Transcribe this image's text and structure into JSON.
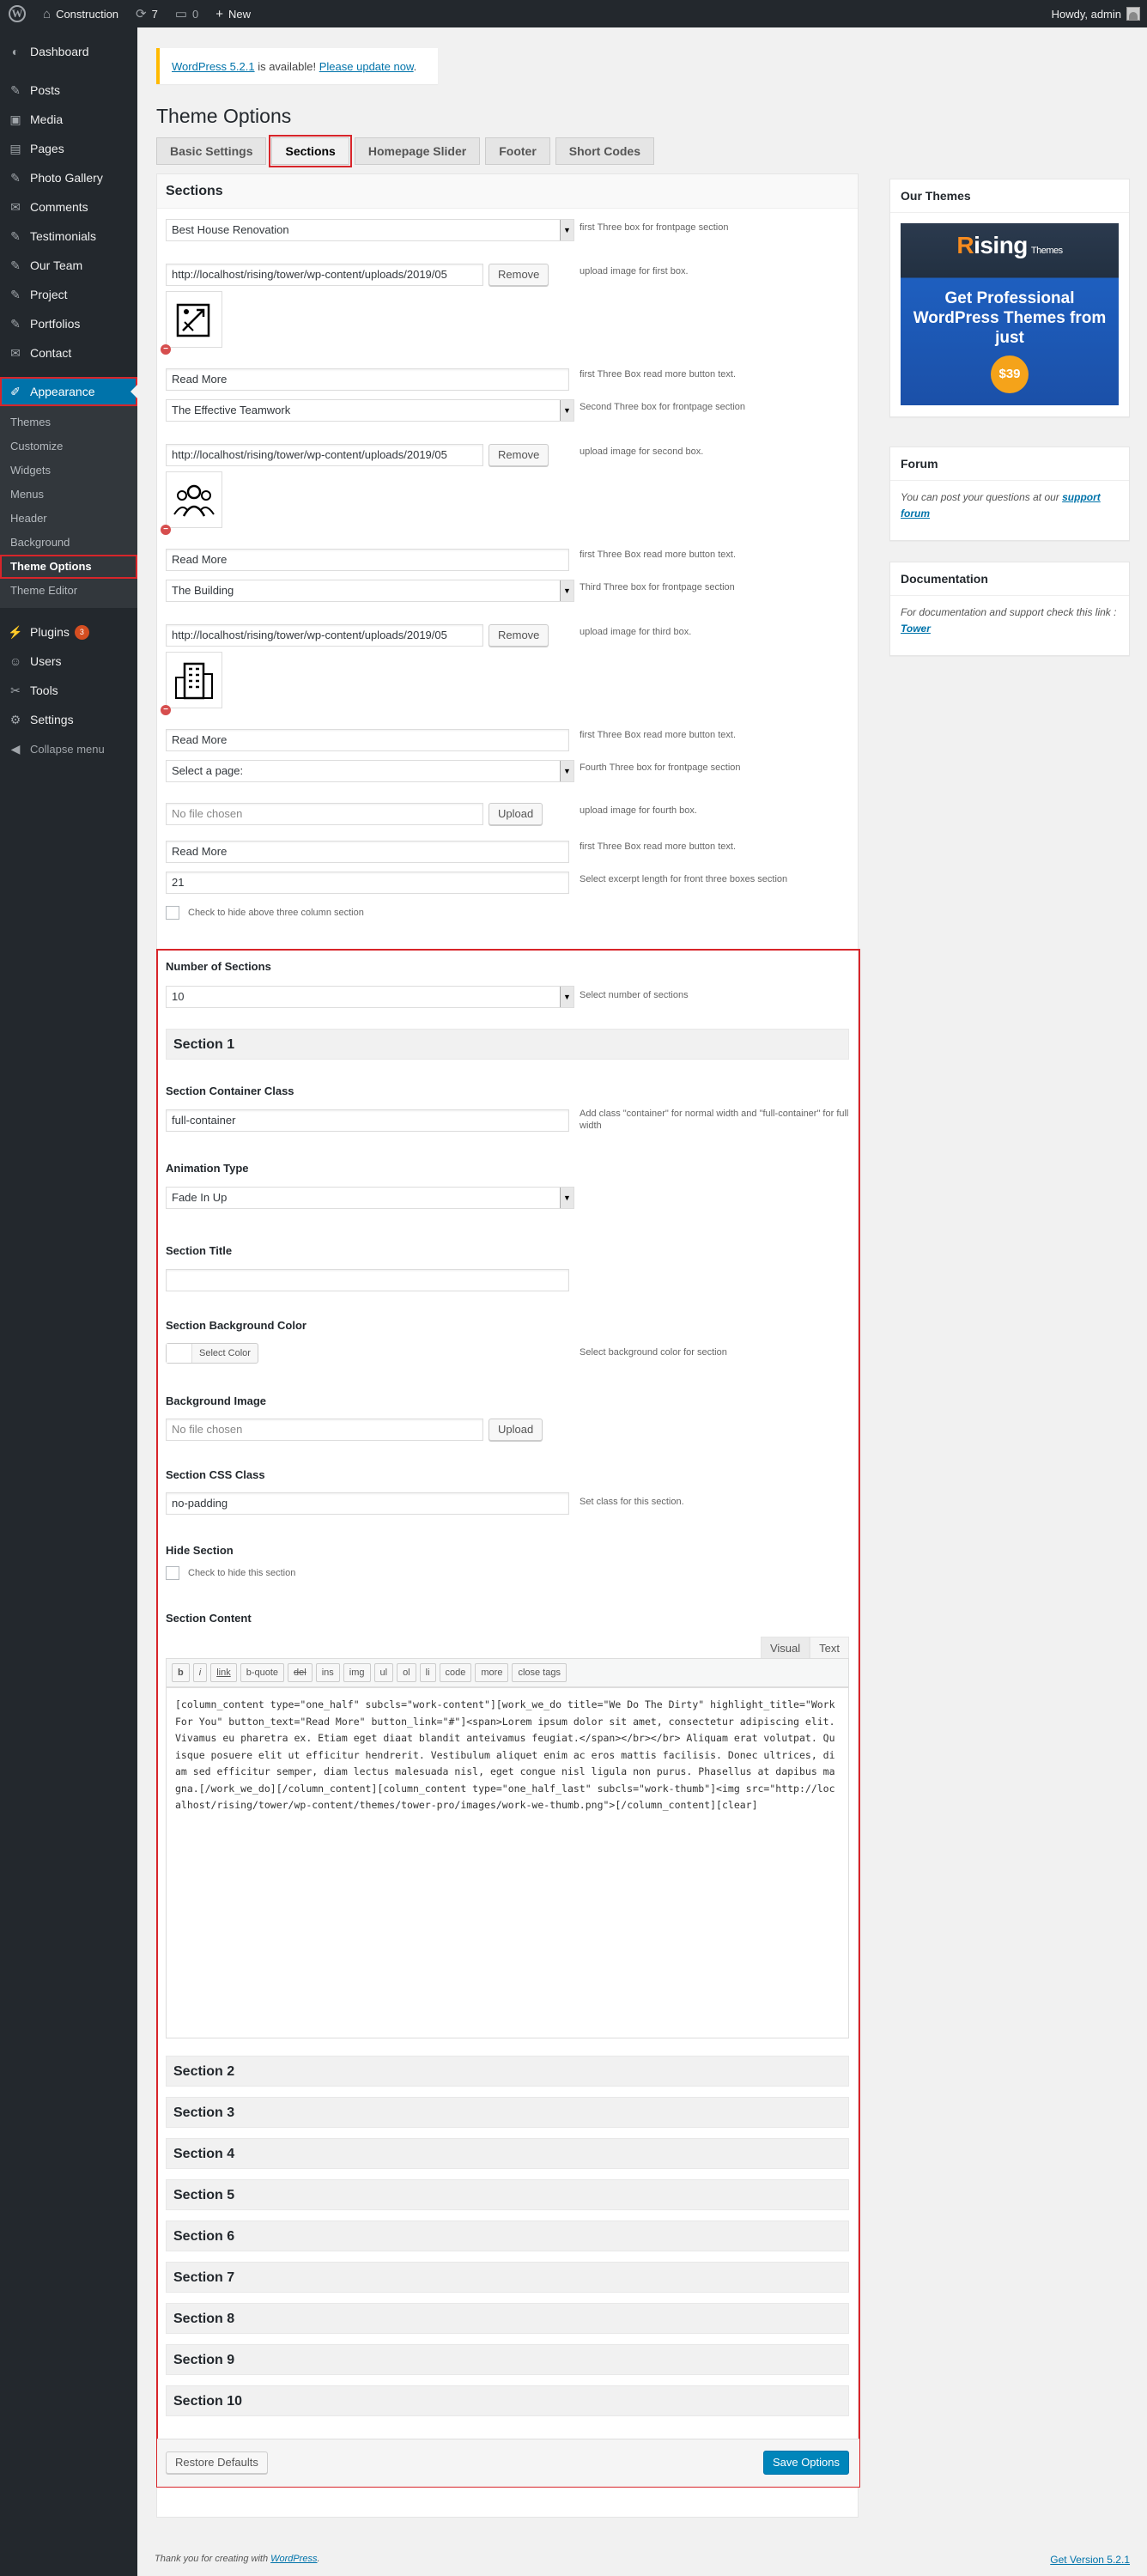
{
  "adminbar": {
    "site_name": "Construction",
    "updates_count": "7",
    "comments_count": "0",
    "new_label": "New",
    "greeting": "Howdy, admin"
  },
  "sidebar": {
    "items": [
      {
        "label": "Dashboard",
        "icon": "dashboard-icon",
        "glyph": "◐"
      },
      {
        "label": "Posts",
        "icon": "pin-icon",
        "glyph": "✎"
      },
      {
        "label": "Media",
        "icon": "media-icon",
        "glyph": "▣"
      },
      {
        "label": "Pages",
        "icon": "pages-icon",
        "glyph": "▤"
      },
      {
        "label": "Photo Gallery",
        "icon": "pin-icon",
        "glyph": "✎"
      },
      {
        "label": "Comments",
        "icon": "comments-icon",
        "glyph": "✉"
      },
      {
        "label": "Testimonials",
        "icon": "pin-icon",
        "glyph": "✎"
      },
      {
        "label": "Our Team",
        "icon": "pin-icon",
        "glyph": "✎"
      },
      {
        "label": "Project",
        "icon": "pin-icon",
        "glyph": "✎"
      },
      {
        "label": "Portfolios",
        "icon": "pin-icon",
        "glyph": "✎"
      },
      {
        "label": "Contact",
        "icon": "mail-icon",
        "glyph": "✉"
      },
      {
        "label": "Appearance",
        "icon": "brush-icon",
        "glyph": "✐"
      },
      {
        "label": "Plugins",
        "icon": "plugin-icon",
        "glyph": "⚡",
        "badge": "3"
      },
      {
        "label": "Users",
        "icon": "users-icon",
        "glyph": "☺"
      },
      {
        "label": "Tools",
        "icon": "wrench-icon",
        "glyph": "✂"
      },
      {
        "label": "Settings",
        "icon": "settings-icon",
        "glyph": "⚙"
      }
    ],
    "appearance_sub": [
      "Themes",
      "Customize",
      "Widgets",
      "Menus",
      "Header",
      "Background",
      "Theme Options",
      "Theme Editor"
    ],
    "collapse_label": "Collapse menu"
  },
  "notice": {
    "link_text": "WordPress 5.2.1",
    "middle_text": " is available! ",
    "update_link": "Please update now",
    "end": "."
  },
  "page_title": "Theme Options",
  "tabs": [
    "Basic Settings",
    "Sections",
    "Homepage Slider",
    "Footer",
    "Short Codes"
  ],
  "active_tab": "Sections",
  "panel_title": "Sections",
  "boxes": {
    "box1_page": "Best House Renovation",
    "box1_page_desc": "first Three box for frontpage section",
    "box1_image_url": "http://localhost/rising/tower/wp-content/uploads/2019/05",
    "box1_image_desc": "upload image for first box.",
    "box1_btn_text": "Read More",
    "box1_btn_desc": "first Three Box read more button text.",
    "box2_page": "The Effective Teamwork",
    "box2_page_desc": "Second Three box for frontpage section",
    "box2_image_url": "http://localhost/rising/tower/wp-content/uploads/2019/05",
    "box2_image_desc": "upload image for second box.",
    "box2_btn_text": "Read More",
    "box2_btn_desc": "first Three Box read more button text.",
    "box3_page": "The Building",
    "box3_page_desc": "Third Three box for frontpage section",
    "box3_image_url": "http://localhost/rising/tower/wp-content/uploads/2019/05",
    "box3_image_desc": "upload image for third box.",
    "box3_btn_text": "Read More",
    "box3_btn_desc": "first Three Box read more button text.",
    "box4_page": "Select a page:",
    "box4_page_desc": "Fourth Three box for frontpage section",
    "box4_image_placeholder": "No file chosen",
    "box4_image_desc": "upload image for fourth box.",
    "box4_btn_text": "Read More",
    "box4_btn_desc": "first Three Box read more button text.",
    "excerpt_length": "21",
    "excerpt_desc": "Select excerpt length for front three boxes section",
    "hide_label": "Check to hide above three column section",
    "remove_label": "Remove",
    "upload_label": "Upload"
  },
  "sections": {
    "number_label": "Number of Sections",
    "number_value": "10",
    "number_desc": "Select number of sections",
    "section1_title": "Section 1",
    "container_class_label": "Section Container Class",
    "container_class_value": "full-container",
    "container_class_desc": "Add class \"container\" for normal width and \"full-container\" for full width",
    "animation_label": "Animation Type",
    "animation_value": "Fade In Up",
    "title_label": "Section Title",
    "title_value": "",
    "bg_color_label": "Section Background Color",
    "bg_color_button": "Select Color",
    "bg_color_desc": "Select background color for section",
    "bg_image_label": "Background Image",
    "bg_image_placeholder": "No file chosen",
    "upload_label": "Upload",
    "css_class_label": "Section CSS Class",
    "css_class_value": "no-padding",
    "css_class_desc": "Set class for this section.",
    "hide_label": "Hide Section",
    "hide_check": "Check to hide this section",
    "content_label": "Section Content",
    "editor_tabs": [
      "Visual",
      "Text"
    ],
    "quicktags": [
      "b",
      "i",
      "link",
      "b-quote",
      "del",
      "ins",
      "img",
      "ul",
      "ol",
      "li",
      "code",
      "more",
      "close tags"
    ],
    "content": "[column_content type=\"one_half\" subcls=\"work-content\"][work_we_do title=\"We Do The Dirty\" highlight_title=\"Work For You\" button_text=\"Read More\" button_link=\"#\"]<span>Lorem ipsum dolor sit amet, consectetur adipiscing elit. Vivamus eu pharetra ex. Etiam eget diaat blandit anteivamus feugiat.</span></br></br> Aliquam erat volutpat. Quisque posuere elit ut efficitur hendrerit. Vestibulum aliquet enim ac eros mattis facilisis. Donec ultrices, diam sed efficitur semper, diam lectus malesuada nisl, eget congue nisl ligula non purus. Phasellus at dapibus magna.[/work_we_do][/column_content][column_content type=\"one_half_last\" subcls=\"work-thumb\"]<img src=\"http://localhost/rising/tower/wp-content/themes/tower-pro/images/work-we-thumb.png\">[/column_content][clear]",
    "collapsed": [
      "Section 2",
      "Section 3",
      "Section 4",
      "Section 5",
      "Section 6",
      "Section 7",
      "Section 8",
      "Section 9",
      "Section 10"
    ],
    "restore_label": "Restore Defaults",
    "save_label": "Save Options"
  },
  "widgets": {
    "themes_title": "Our Themes",
    "promo_brand_r": "R",
    "promo_brand_rest": "ising",
    "promo_brand_small": "Themes",
    "promo_tagline": "Get Professional WordPress Themes from just",
    "promo_price": "$39",
    "forum_title": "Forum",
    "forum_text": "You can post your questions at our ",
    "forum_link": "support forum",
    "doc_title": "Documentation",
    "doc_text": "For documentation and support check this link : ",
    "doc_link": "Tower"
  },
  "footer": {
    "thanks_text": "Thank you for creating with ",
    "wp_link": "WordPress",
    "thanks_end": ".",
    "version_link": "Get Version 5.2.1"
  }
}
